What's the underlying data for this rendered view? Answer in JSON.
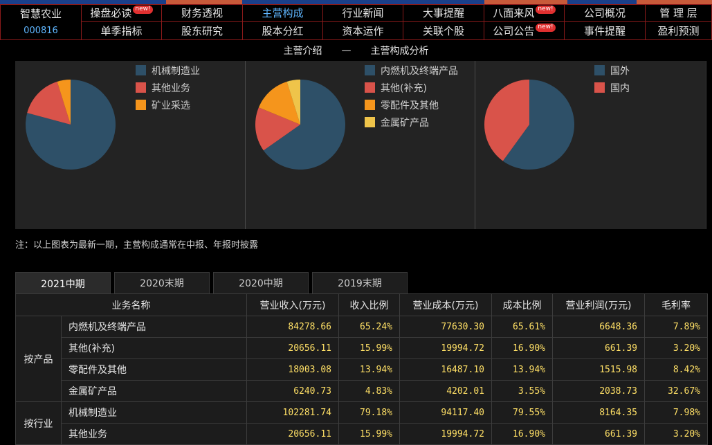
{
  "colors": {
    "accent_blue": "#5fb6ff",
    "nav_border": "#8a1a1a",
    "number_yellow": "#ffe066",
    "badge_red": "#e03030",
    "slice_dark_blue": "#2e5068",
    "slice_red": "#d9534a",
    "slice_orange": "#f5951c",
    "slice_yellow": "#efc44a"
  },
  "stock": {
    "name": "智慧农业",
    "code": "000816"
  },
  "nav": {
    "row1": [
      {
        "label": "操盘必读",
        "badge": "new!"
      },
      {
        "label": "财务透视",
        "badge": ""
      },
      {
        "label": "主营构成",
        "badge": "",
        "active": true
      },
      {
        "label": "行业新闻",
        "badge": ""
      },
      {
        "label": "大事提醒",
        "badge": ""
      },
      {
        "label": "八面来风",
        "badge": "new!"
      },
      {
        "label": "公司概况",
        "badge": ""
      },
      {
        "label": "管 理 层",
        "badge": ""
      }
    ],
    "row2": [
      {
        "label": "单季指标",
        "badge": ""
      },
      {
        "label": "股东研究",
        "badge": ""
      },
      {
        "label": "股本分红",
        "badge": ""
      },
      {
        "label": "资本运作",
        "badge": ""
      },
      {
        "label": "关联个股",
        "badge": ""
      },
      {
        "label": "公司公告",
        "badge": "new!"
      },
      {
        "label": "事件提醒",
        "badge": ""
      },
      {
        "label": "盈利预测",
        "badge": ""
      }
    ]
  },
  "section": {
    "left": "主营介绍",
    "sep": "—",
    "right": "主营构成分析"
  },
  "chart_data": [
    {
      "type": "pie",
      "title": "",
      "legend_placement": "top-right",
      "series": [
        {
          "name": "机械制造业",
          "value": 79.18,
          "color": "#2e5068"
        },
        {
          "name": "其他业务",
          "value": 15.99,
          "color": "#d9534a"
        },
        {
          "name": "矿业采选",
          "value": 4.83,
          "color": "#f5951c"
        }
      ]
    },
    {
      "type": "pie",
      "title": "",
      "legend_placement": "top-right",
      "series": [
        {
          "name": "内燃机及终端产品",
          "value": 65.24,
          "color": "#2e5068"
        },
        {
          "name": "其他(补充)",
          "value": 15.99,
          "color": "#d9534a"
        },
        {
          "name": "零配件及其他",
          "value": 13.94,
          "color": "#f5951c"
        },
        {
          "name": "金属矿产品",
          "value": 4.83,
          "color": "#efc44a"
        }
      ]
    },
    {
      "type": "pie",
      "title": "",
      "legend_placement": "top-right",
      "series": [
        {
          "name": "国外",
          "value": 60.0,
          "color": "#2e5068"
        },
        {
          "name": "国内",
          "value": 40.0,
          "color": "#d9534a"
        }
      ]
    }
  ],
  "note": "注：以上图表为最新一期，主营构成通常在中报、年报时披露",
  "tabs": [
    {
      "label": "2021中期",
      "active": true
    },
    {
      "label": "2020末期",
      "active": false
    },
    {
      "label": "2020中期",
      "active": false
    },
    {
      "label": "2019末期",
      "active": false
    }
  ],
  "table": {
    "headers": [
      "业务名称",
      "营业收入(万元)",
      "收入比例",
      "营业成本(万元)",
      "成本比例",
      "营业利润(万元)",
      "毛利率"
    ],
    "groups": [
      {
        "label": "按产品",
        "rows": [
          [
            "内燃机及终端产品",
            "84278.66",
            "65.24%",
            "77630.30",
            "65.61%",
            "6648.36",
            "7.89%"
          ],
          [
            "其他(补充)",
            "20656.11",
            "15.99%",
            "19994.72",
            "16.90%",
            "661.39",
            "3.20%"
          ],
          [
            "零配件及其他",
            "18003.08",
            "13.94%",
            "16487.10",
            "13.94%",
            "1515.98",
            "8.42%"
          ],
          [
            "金属矿产品",
            "6240.73",
            "4.83%",
            "4202.01",
            "3.55%",
            "2038.73",
            "32.67%"
          ]
        ]
      },
      {
        "label": "按行业",
        "rows": [
          [
            "机械制造业",
            "102281.74",
            "79.18%",
            "94117.40",
            "79.55%",
            "8164.35",
            "7.98%"
          ],
          [
            "其他业务",
            "20656.11",
            "15.99%",
            "19994.72",
            "16.90%",
            "661.39",
            "3.20%"
          ]
        ]
      }
    ]
  }
}
